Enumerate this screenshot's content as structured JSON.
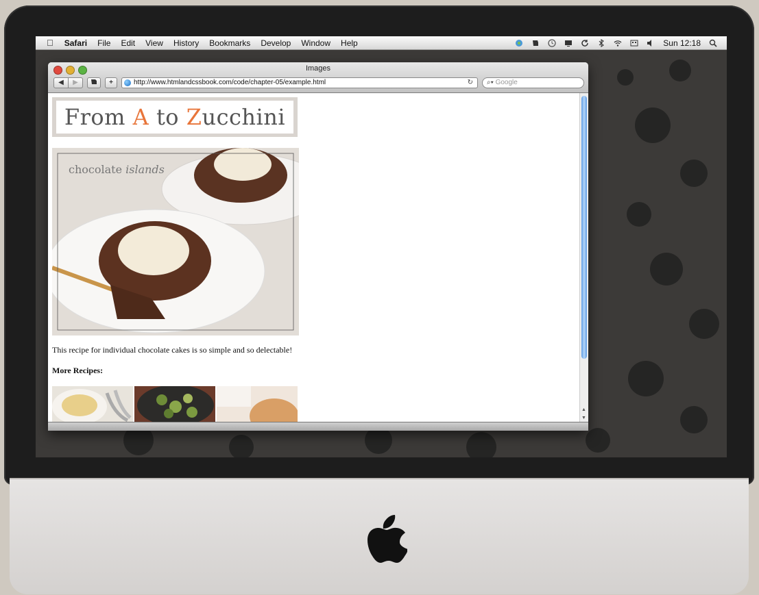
{
  "menubar": {
    "app_name": "Safari",
    "items": [
      "File",
      "Edit",
      "View",
      "History",
      "Bookmarks",
      "Develop",
      "Window",
      "Help"
    ],
    "clock": "Sun 12:18",
    "status_icons": [
      "evernote-icon",
      "evernote-icon",
      "time-machine-icon",
      "display-icon",
      "sync-icon",
      "bluetooth-icon",
      "wifi-icon",
      "keyboard-icon",
      "volume-icon",
      "spotlight-icon"
    ]
  },
  "window": {
    "title": "Images",
    "url": "http://www.htmlandcssbook.com/code/chapter-05/example.html",
    "search_placeholder": "Google",
    "back_label": "◀",
    "forward_label": "▶",
    "add_label": "+"
  },
  "page": {
    "logo": {
      "part1": "From ",
      "letter1": "A",
      "part2": " to ",
      "letter2": "Z",
      "part3": "ucchini"
    },
    "hero_caption": {
      "word1": "chocolate",
      "word2": "islands"
    },
    "description": "This recipe for individual chocolate cakes is so simple and so delectable!",
    "more_heading": "More Recipes:"
  },
  "colors": {
    "accent": "#e8753a",
    "scroll_thumb": "#5d9be3"
  }
}
